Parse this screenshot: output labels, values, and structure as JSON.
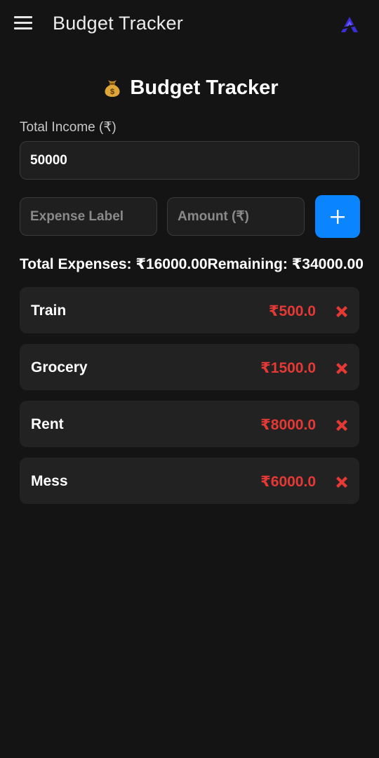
{
  "app_bar": {
    "title": "Budget Tracker",
    "menu_icon": "hamburger-menu-icon",
    "logo_icon": "brand-logo-icon"
  },
  "header": {
    "emoji_icon": "money-bag-icon",
    "title": "Budget Tracker"
  },
  "income": {
    "label": "Total Income (₹)",
    "value": "50000"
  },
  "expense_form": {
    "label_placeholder": "Expense Label",
    "amount_placeholder": "Amount (₹)",
    "add_icon": "plus-icon"
  },
  "summary": {
    "text": "Total Expenses: ₹16000.00Remaining: ₹34000.00"
  },
  "expenses": [
    {
      "name": "Train",
      "amount": "₹500.0"
    },
    {
      "name": "Grocery",
      "amount": "₹1500.0"
    },
    {
      "name": "Rent",
      "amount": "₹8000.0"
    },
    {
      "name": "Mess",
      "amount": "₹6000.0"
    }
  ],
  "colors": {
    "background": "#141414",
    "accent": "#0a84ff",
    "expense_amount": "#e53935",
    "delete": "#e53935",
    "logo": "#3a2fd6"
  }
}
